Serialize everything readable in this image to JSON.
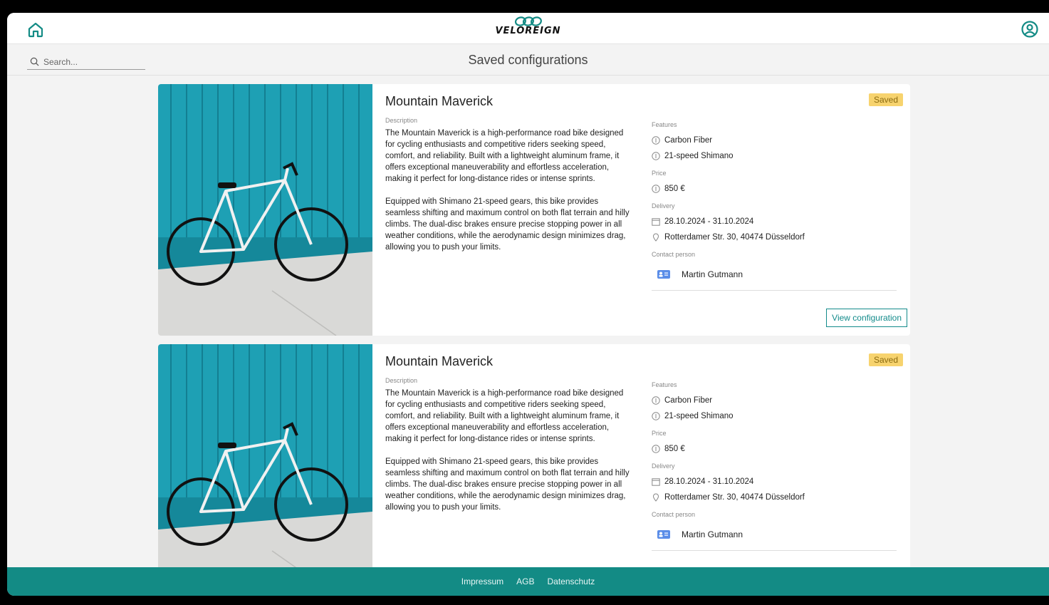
{
  "brand": {
    "name": "VELOREIGN",
    "accent": "#138b85",
    "badge_color": "#f7d36e"
  },
  "header": {
    "home_icon": "home-icon",
    "profile_icon": "user-circle-icon"
  },
  "search": {
    "placeholder": "Search..."
  },
  "page": {
    "title": "Saved configurations"
  },
  "cards": [
    {
      "title": "Mountain Maverick",
      "badge": "Saved",
      "description_label": "Description",
      "description_p1": "The Mountain Maverick is a high-performance road bike designed for cycling enthusiasts and competitive riders seeking speed, comfort, and reliability. Built with a lightweight aluminum frame, it offers exceptional maneuverability and effortless acceleration, making it perfect for long-distance rides or intense sprints.",
      "description_p2": "Equipped with Shimano 21-speed gears, this bike provides seamless shifting and maximum control on both flat terrain and hilly climbs. The dual-disc brakes ensure precise stopping power in all weather conditions, while the aerodynamic design minimizes drag, allowing you to push your limits.",
      "features_label": "Features",
      "features": [
        "Carbon Fiber",
        "21-speed Shimano"
      ],
      "price_label": "Price",
      "price": "850 €",
      "delivery_label": "Delivery",
      "delivery_dates": "28.10.2024 - 31.10.2024",
      "delivery_address": "Rotterdamer Str. 30, 40474 Düsseldorf",
      "contact_label": "Contact person",
      "contact_name": "Martin Gutmann",
      "button": "View configuration"
    },
    {
      "title": "Mountain Maverick",
      "badge": "Saved",
      "description_label": "Description",
      "description_p1": "The Mountain Maverick is a high-performance road bike designed for cycling enthusiasts and competitive riders seeking speed, comfort, and reliability. Built with a lightweight aluminum frame, it offers exceptional maneuverability and effortless acceleration, making it perfect for long-distance rides or intense sprints.",
      "description_p2": "Equipped with Shimano 21-speed gears, this bike provides seamless shifting and maximum control on both flat terrain and hilly climbs. The dual-disc brakes ensure precise stopping power in all weather conditions, while the aerodynamic design minimizes drag, allowing you to push your limits.",
      "features_label": "Features",
      "features": [
        "Carbon Fiber",
        "21-speed Shimano"
      ],
      "price_label": "Price",
      "price": "850 €",
      "delivery_label": "Delivery",
      "delivery_dates": "28.10.2024 - 31.10.2024",
      "delivery_address": "Rotterdamer Str. 30, 40474 Düsseldorf",
      "contact_label": "Contact person",
      "contact_name": "Martin Gutmann"
    }
  ],
  "footer": {
    "links": [
      "Impressum",
      "AGB",
      "Datenschutz"
    ]
  }
}
